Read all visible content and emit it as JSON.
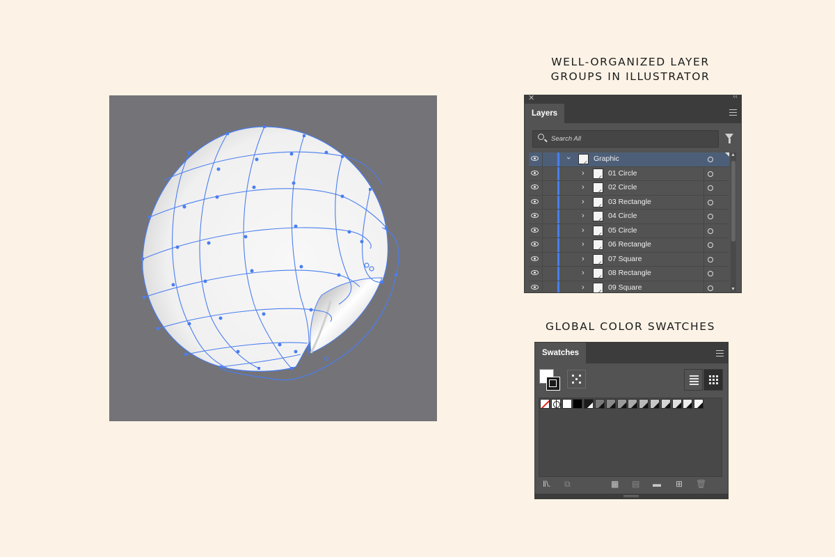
{
  "headings": {
    "layers_line1": "WELL-ORGANIZED LAYER",
    "layers_line2": "GROUPS IN ILLUSTRATOR",
    "swatches": "GLOBAL COLOR SWATCHES"
  },
  "canvas": {
    "background": "#747377",
    "artwork": "peeling circular sticker with envelope-distort mesh",
    "mesh_color": "#4a7ef0"
  },
  "layers_panel": {
    "tab_label": "Layers",
    "search_placeholder": "Search All",
    "group": {
      "label": "Graphic"
    },
    "rows": [
      {
        "label": "01 Circle"
      },
      {
        "label": "02 Circle"
      },
      {
        "label": "03 Rectangle"
      },
      {
        "label": "04 Circle"
      },
      {
        "label": "05 Circle"
      },
      {
        "label": "06 Rectangle"
      },
      {
        "label": "07 Square"
      },
      {
        "label": "08 Rectangle"
      },
      {
        "label": "09 Square"
      }
    ],
    "layer_color": "#4a7ef0",
    "selected_row_color": "#4d5f78"
  },
  "swatches_panel": {
    "tab_label": "Swatches",
    "swatches": [
      {
        "kind": "none"
      },
      {
        "kind": "registration"
      },
      {
        "kind": "color",
        "color": "#ffffff"
      },
      {
        "kind": "color",
        "color": "#000000"
      },
      {
        "kind": "global",
        "color": "#1a1a1a"
      },
      {
        "kind": "global",
        "color": "#7a7a7a"
      },
      {
        "kind": "global",
        "color": "#8a8a8a"
      },
      {
        "kind": "global",
        "color": "#9a9a9a"
      },
      {
        "kind": "global",
        "color": "#aaaaaa"
      },
      {
        "kind": "global",
        "color": "#b8b8b8"
      },
      {
        "kind": "global",
        "color": "#c6c6c6"
      },
      {
        "kind": "global",
        "color": "#d4d4d4"
      },
      {
        "kind": "global",
        "color": "#e0e0e0"
      },
      {
        "kind": "global",
        "color": "#ececec"
      },
      {
        "kind": "global",
        "color": "#f6f6f6"
      }
    ]
  }
}
